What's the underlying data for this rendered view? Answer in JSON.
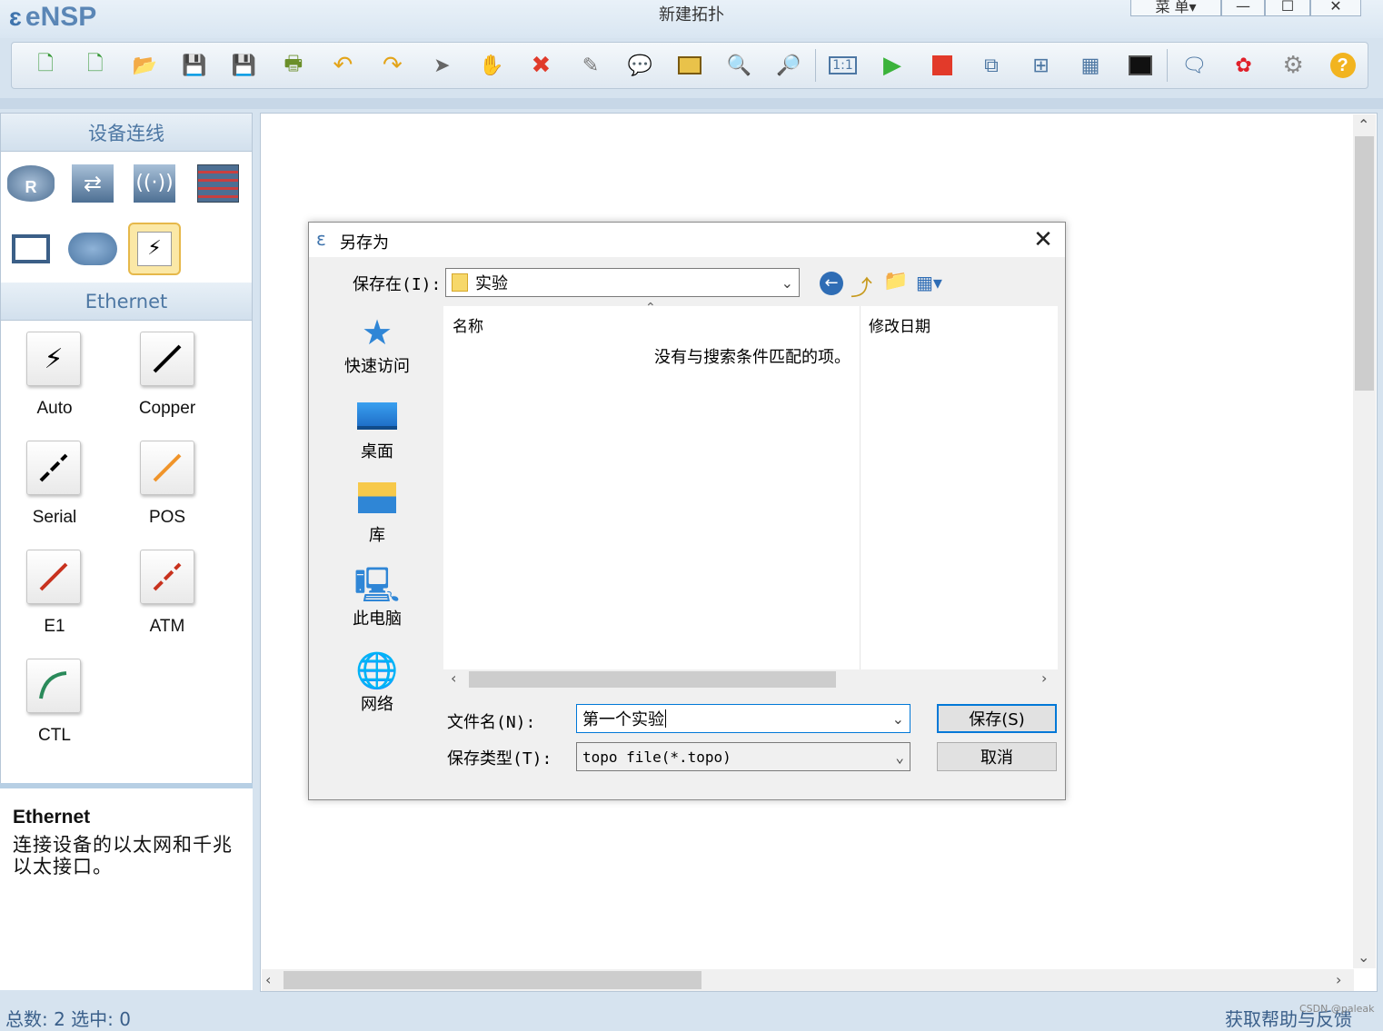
{
  "app": {
    "logo": "eNSP",
    "window_title": "新建拓扑",
    "menu_label": "菜 单▾",
    "minimize": "—",
    "maximize": "☐",
    "close": "✕"
  },
  "toolbar": {
    "icons": [
      "new-topology-icon",
      "new-topo-icon",
      "open-icon",
      "save-icon",
      "save-as-icon",
      "print-icon",
      "undo-icon",
      "redo-icon",
      "select-pointer-icon",
      "hand-pan-icon",
      "delete-icon",
      "delete-link-icon",
      "text-note-icon",
      "rectangle-icon",
      "zoom-in-icon",
      "zoom-out-icon",
      "actual-size-icon",
      "start-device-icon",
      "stop-device-icon",
      "capture-icon",
      "topology-tree-icon",
      "grid-icon",
      "terminal-icon",
      "chat-icon",
      "huawei-icon",
      "settings-icon",
      "help-icon"
    ]
  },
  "left_panel": {
    "header_devices": "设备连线",
    "header_category": "Ethernet",
    "devices": [
      "router-icon",
      "switch-icon",
      "wireless-icon",
      "firewall-icon",
      "pc-icon",
      "cloud-icon",
      "link-icon"
    ],
    "cables": [
      {
        "label": "Auto"
      },
      {
        "label": "Copper"
      },
      {
        "label": "Serial"
      },
      {
        "label": "POS"
      },
      {
        "label": "E1"
      },
      {
        "label": "ATM"
      },
      {
        "label": "CTL"
      }
    ],
    "info_title": "Ethernet",
    "info_desc": "连接设备的以太网和千兆以太接口。"
  },
  "dialog": {
    "title": "另存为",
    "save_in_label": "保存在(I):",
    "save_in_value": "实验",
    "places": [
      "快速访问",
      "桌面",
      "库",
      "此电脑",
      "网络"
    ],
    "col_name": "名称",
    "col_date": "修改日期",
    "empty_message": "没有与搜索条件匹配的项。",
    "filename_label": "文件名(N):",
    "filename_value": "第一个实验",
    "filetype_label": "保存类型(T):",
    "filetype_value": "topo file(*.topo)",
    "save_button": "保存(S)",
    "cancel_button": "取消"
  },
  "status": {
    "left": "总数: 2 选中: 0",
    "right": "获取帮助与反馈",
    "watermark": "CSDN @paleak"
  },
  "colors": {
    "accent": "#0078d7",
    "panel_header_text": "#4d77a3",
    "brand": "#5a86b6"
  }
}
